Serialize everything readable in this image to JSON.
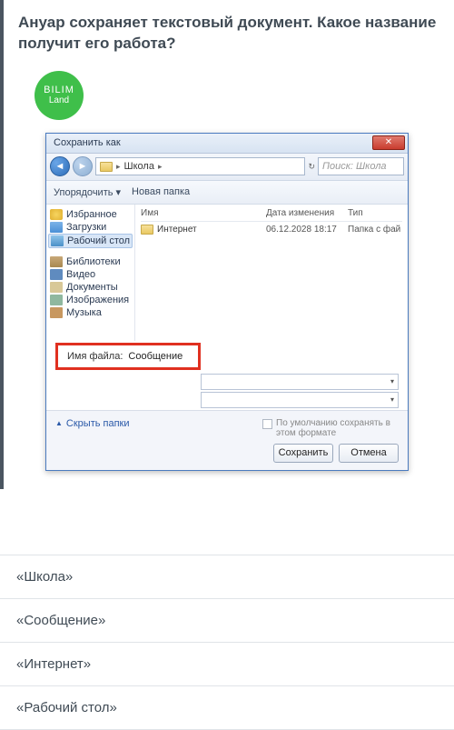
{
  "question": "Ануар сохраняет текстовый документ. Какое название получит его работа?",
  "logo": {
    "line1": "BILIM",
    "line2": "Land"
  },
  "dialog": {
    "title": "Сохранить как",
    "close": "✕",
    "nav_back": "◄",
    "nav_fwd": "►",
    "location_chev": "▸",
    "location_folder": "Школа",
    "location_chev2": "▸",
    "search_placeholder": "Поиск: Школа",
    "refresh": "↻",
    "toolbar_organize": "Упорядочить ▾",
    "toolbar_newfolder": "Новая папка",
    "tree": {
      "favorites": "Избранное",
      "downloads": "Загрузки",
      "desktop": "Рабочий стол",
      "libraries": "Библиотеки",
      "video": "Видео",
      "documents": "Документы",
      "images": "Изображения",
      "music": "Музыка"
    },
    "columns": {
      "name": "Имя",
      "date": "Дата изменения",
      "type": "Тип"
    },
    "rows": [
      {
        "name": "Интернет",
        "date": "06.12.2028 18:17",
        "type": "Папка с фай"
      }
    ],
    "filename_label": "Имя файла:",
    "filename_value": "Сообщение",
    "dropdown_arrow": "▾",
    "hide_folders": "Скрыть папки",
    "hide_chev": "▲",
    "default_text": "По умолчанию сохранять в этом формате",
    "save": "Сохранить",
    "cancel": "Отмена"
  },
  "answers": [
    "«Школа»",
    "«Сообщение»",
    "«Интернет»",
    "«Рабочий стол»"
  ]
}
